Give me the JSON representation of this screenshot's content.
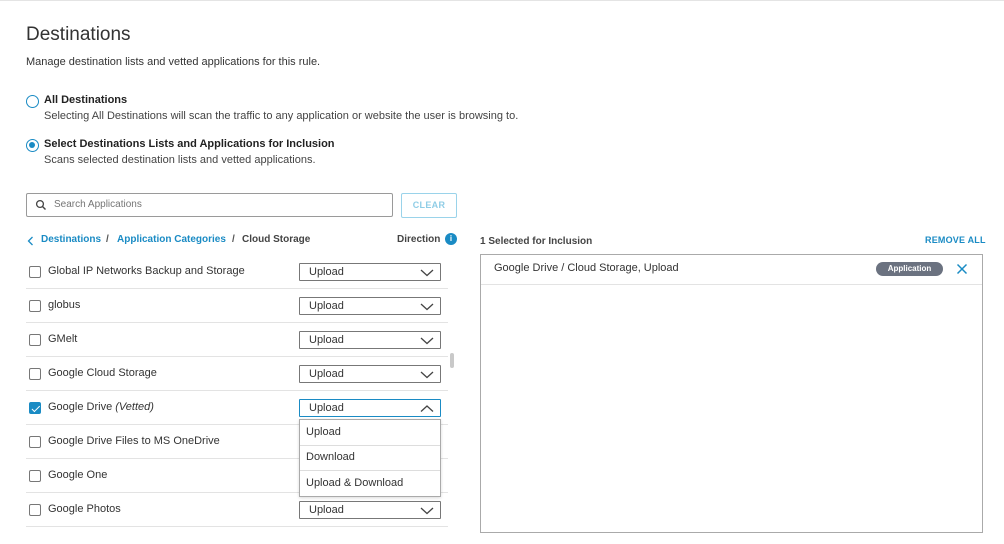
{
  "header": {
    "title": "Destinations",
    "subtitle": "Manage destination lists and vetted applications for this rule."
  },
  "options": [
    {
      "label": "All Destinations",
      "description": "Selecting All Destinations will scan the traffic to any application or website the user is browsing to.",
      "selected": false
    },
    {
      "label": "Select Destinations Lists and Applications for Inclusion",
      "description": "Scans selected destination lists and vetted applications.",
      "selected": true
    }
  ],
  "search": {
    "placeholder": "Search Applications",
    "clear_label": "CLEAR"
  },
  "breadcrumb": {
    "items": [
      "Destinations",
      "Application Categories"
    ],
    "current": "Cloud Storage",
    "separator": "/"
  },
  "direction_header": "Direction",
  "apps": [
    {
      "name": "Global IP Networks Backup and Storage",
      "vetted": "",
      "checked": false,
      "direction": "Upload"
    },
    {
      "name": "globus",
      "vetted": "",
      "checked": false,
      "direction": "Upload"
    },
    {
      "name": "GMelt",
      "vetted": "",
      "checked": false,
      "direction": "Upload"
    },
    {
      "name": "Google Cloud Storage",
      "vetted": "",
      "checked": false,
      "direction": "Upload"
    },
    {
      "name": "Google Drive",
      "vetted": "(Vetted)",
      "checked": true,
      "direction": "Upload"
    },
    {
      "name": "Google Drive Files to MS OneDrive",
      "vetted": "",
      "checked": false,
      "direction": ""
    },
    {
      "name": "Google One",
      "vetted": "",
      "checked": false,
      "direction": ""
    },
    {
      "name": "Google Photos",
      "vetted": "",
      "checked": false,
      "direction": "Upload"
    }
  ],
  "direction_dropdown": {
    "options": [
      "Upload",
      "Download",
      "Upload & Download"
    ]
  },
  "selection": {
    "header": "1 Selected for Inclusion",
    "remove_all": "REMOVE ALL",
    "items": [
      {
        "text": "Google Drive / Cloud Storage, Upload",
        "badge": "Application"
      }
    ]
  },
  "colors": {
    "accent": "#1a8bc4",
    "badge": "#6b7280"
  }
}
